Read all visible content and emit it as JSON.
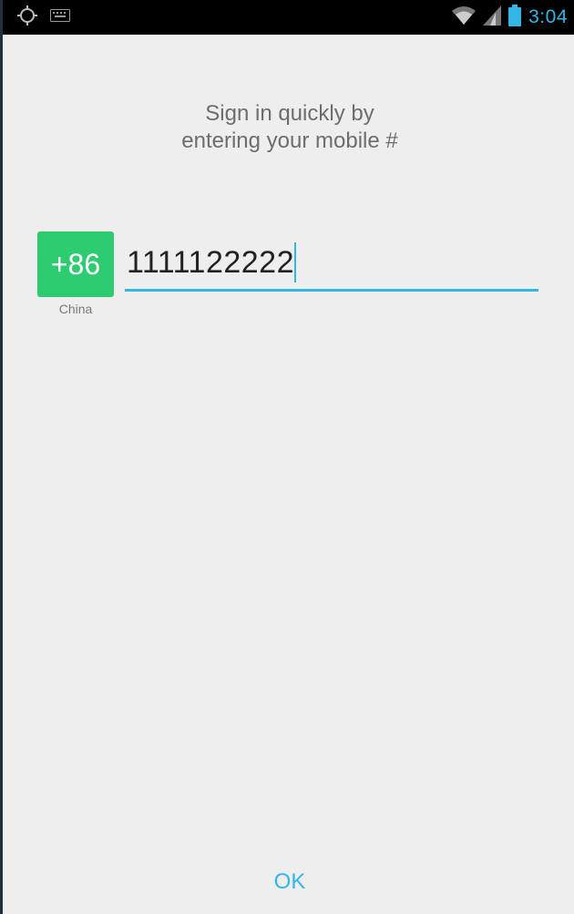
{
  "status_bar": {
    "time": "3:04",
    "icons": [
      "gps-icon",
      "keyboard-icon",
      "wifi-icon",
      "signal-icon",
      "battery-icon"
    ],
    "accent_color": "#33b5e5"
  },
  "headline": {
    "line1": "Sign in quickly by",
    "line2": "entering your mobile #"
  },
  "country": {
    "code": "+86",
    "name": "China",
    "color": "#2ecc71"
  },
  "phone": {
    "value": "1111122222"
  },
  "actions": {
    "ok_label": "OK"
  }
}
